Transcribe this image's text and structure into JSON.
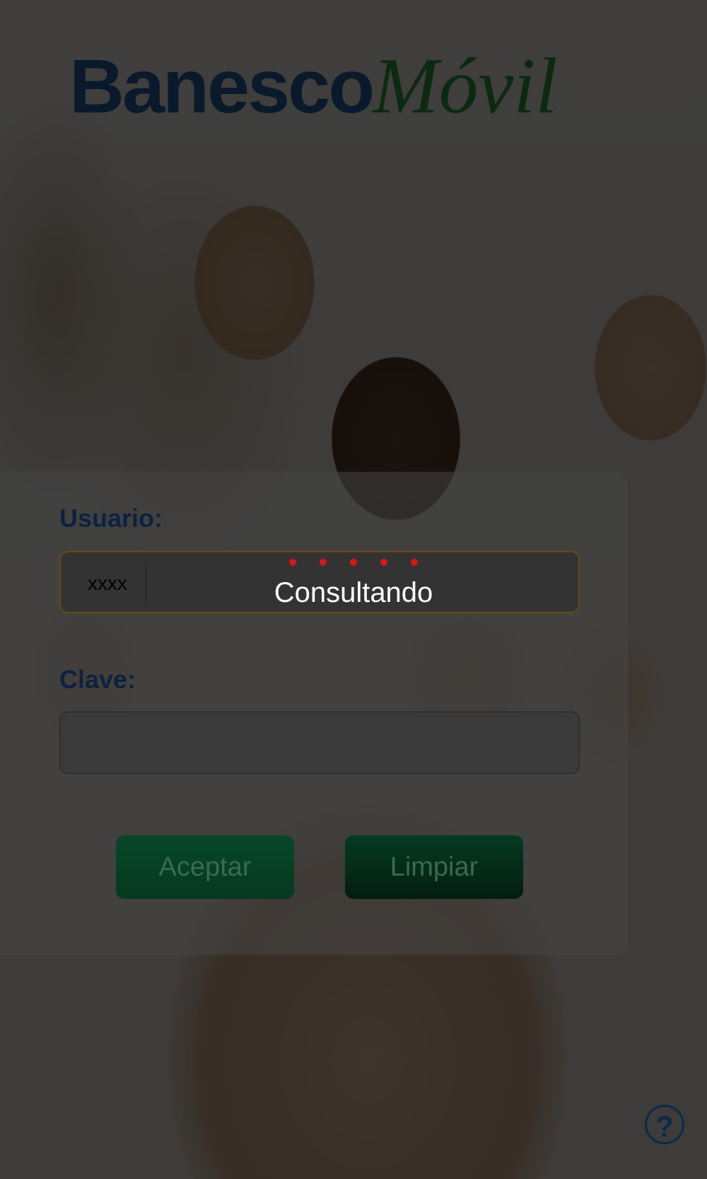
{
  "app": {
    "logo_primary": "Banesco",
    "logo_secondary": "Móvil"
  },
  "login": {
    "user_label": "Usuario:",
    "user_prefix": "xxxx",
    "user_value": "",
    "password_label": "Clave:",
    "password_value": ""
  },
  "buttons": {
    "accept_label": "Aceptar",
    "clear_label": "Limpiar"
  },
  "loading": {
    "text": "Consultando",
    "dot_count": 5,
    "dot_color": "#e01414"
  },
  "help": {
    "icon": "help-icon",
    "glyph": "?"
  },
  "colors": {
    "brand_blue": "#0b2240",
    "brand_green": "#0c2a12",
    "button_green": "#07472a"
  }
}
